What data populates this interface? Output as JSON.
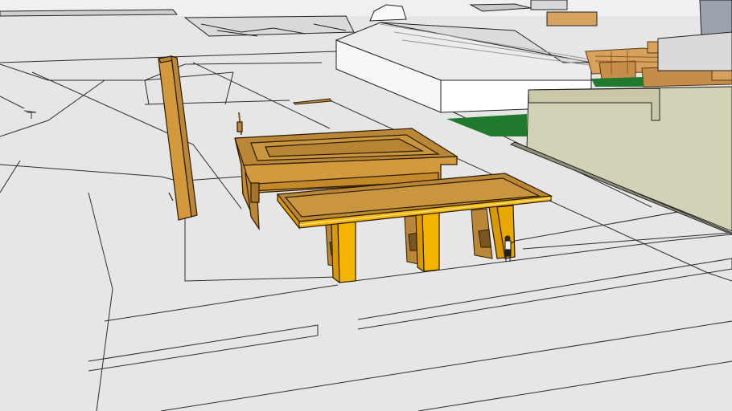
{
  "scene": {
    "model_name": "",
    "colors": {
      "ground": "#e6e6e6",
      "sky": "#f2f2f2",
      "edge": "#2a2a2a",
      "canopy_orange": "#c48a2a",
      "canopy_trim": "#f3a81a",
      "pillar_yellow": "#f5b400",
      "building_top": "#b98735",
      "building_side": "#d29a3c",
      "warehouse_wall": "#ffffff",
      "warehouse_roof": "#ececec",
      "tan_building": "#d8d6bb",
      "grass": "#1f7a2e",
      "crate": "#d7a15e"
    },
    "objects": [
      "gas-station-canopy",
      "convenience-store",
      "price-sign-pylon",
      "fuel-pump",
      "person-figure",
      "warehouse",
      "tan-building",
      "lumber-stacks",
      "grass-patch",
      "ground-grid"
    ]
  }
}
